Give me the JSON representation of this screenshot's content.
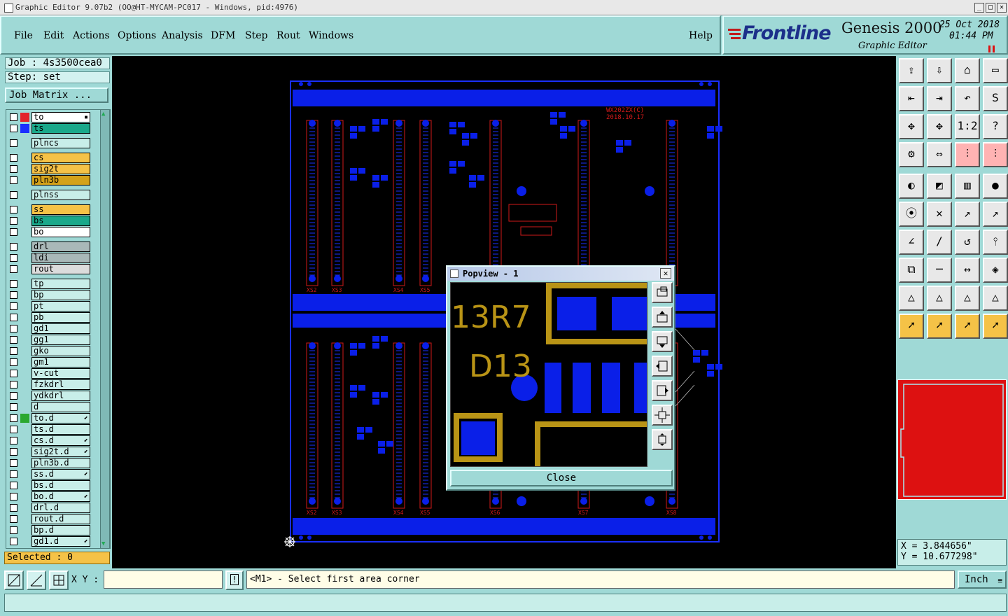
{
  "window": {
    "title": "Graphic Editor 9.07b2 (OO@HT-MYCAM-PC017 - Windows, pid:4976)"
  },
  "menu": {
    "items": [
      "File",
      "Edit",
      "Actions",
      "Options",
      "Analysis",
      "DFM",
      "Step",
      "Rout",
      "Windows"
    ],
    "help": "Help"
  },
  "brand": {
    "logo": "Frontline",
    "product": "Genesis 2000",
    "subtitle": "Graphic Editor",
    "date": "25 Oct 2018",
    "time": "01:44 PM"
  },
  "job": {
    "job_line": "Job : 4s3500cea0",
    "step_line": "Step: set",
    "matrix_button": "Job Matrix ..."
  },
  "layers": [
    {
      "name": "to",
      "bg": "#ffffff"
    },
    {
      "name": "ts",
      "bg": "#1aa88a"
    },
    {
      "name": "plncs",
      "bg": "#c8eee9"
    },
    {
      "name": "cs",
      "bg": "#f5c247"
    },
    {
      "name": "sig2t",
      "bg": "#f5c247"
    },
    {
      "name": "pln3b",
      "bg": "#d4a21a"
    },
    {
      "name": "plnss",
      "bg": "#c8eee9"
    },
    {
      "name": "ss",
      "bg": "#f5c247"
    },
    {
      "name": "bs",
      "bg": "#1aa88a"
    },
    {
      "name": "bo",
      "bg": "#ffffff"
    },
    {
      "name": "drl",
      "bg": "#a9b8b8"
    },
    {
      "name": "ldi",
      "bg": "#a9b8b8"
    },
    {
      "name": "rout",
      "bg": "#dcdcdc"
    },
    {
      "name": "tp",
      "bg": "#c8eee9"
    },
    {
      "name": "bp",
      "bg": "#c8eee9"
    },
    {
      "name": "pt",
      "bg": "#c8eee9"
    },
    {
      "name": "pb",
      "bg": "#c8eee9"
    },
    {
      "name": "gd1",
      "bg": "#c8eee9"
    },
    {
      "name": "gg1",
      "bg": "#c8eee9"
    },
    {
      "name": "gko",
      "bg": "#c8eee9"
    },
    {
      "name": "gm1",
      "bg": "#c8eee9"
    },
    {
      "name": "v-cut",
      "bg": "#c8eee9"
    },
    {
      "name": "fzkdrl",
      "bg": "#c8eee9"
    },
    {
      "name": "ydkdrl",
      "bg": "#c8eee9"
    },
    {
      "name": "d",
      "bg": "#c8eee9"
    },
    {
      "name": "to.d",
      "bg": "#c8eee9"
    },
    {
      "name": "ts.d",
      "bg": "#c8eee9"
    },
    {
      "name": "cs.d",
      "bg": "#c8eee9"
    },
    {
      "name": "sig2t.d",
      "bg": "#c8eee9"
    },
    {
      "name": "pln3b.d",
      "bg": "#c8eee9"
    },
    {
      "name": "ss.d",
      "bg": "#c8eee9"
    },
    {
      "name": "bs.d",
      "bg": "#c8eee9"
    },
    {
      "name": "bo.d",
      "bg": "#c8eee9"
    },
    {
      "name": "drl.d",
      "bg": "#c8eee9"
    },
    {
      "name": "rout.d",
      "bg": "#c8eee9"
    },
    {
      "name": "bp.d",
      "bg": "#c8eee9"
    },
    {
      "name": "gd1.d",
      "bg": "#c8eee9"
    }
  ],
  "selected": "Selected : 0",
  "board": {
    "label_top": "WX202ZX(C)",
    "label_date": "2018.10.17",
    "top_connectors": [
      "XS2",
      "XS3",
      "XS4",
      "XS5"
    ],
    "bottom_connectors": [
      "XS2",
      "XS3",
      "XS4",
      "XS5",
      "XS6",
      "XS7",
      "XS8"
    ]
  },
  "popview": {
    "title": "Popview - 1",
    "label_a": "13R7",
    "label_b": "D13",
    "close": "Close"
  },
  "coords": {
    "x": "X = 3.844656\"",
    "y": "Y = 10.677298\""
  },
  "status": {
    "xy_label": "X Y :",
    "xy_value": "",
    "prompt": "<M1> - Select first area corner",
    "unit": "Inch"
  },
  "colors": {
    "bg": "#9fd9d6",
    "board_blue": "#0a1fe8",
    "trace_red": "#d11a1a",
    "pad_gold": "#b99416"
  }
}
